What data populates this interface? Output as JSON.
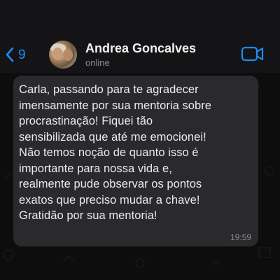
{
  "header": {
    "back_count": "9",
    "contact_name": "Andrea Goncalves",
    "status": "online",
    "accent_color": "#1e8df5"
  },
  "icons": {
    "back": "chevron-left-icon",
    "video": "video-call-icon"
  },
  "message": {
    "text": "Carla, passando para te agradecer\nimensamente por sua mentoria sobre\nprocrastinação! Fiquei tão\nsensibilizada que até me emocionei!\nNão temos noção de quanto isso é\nimportante para nossa vida e,\nrealmente pude observar os pontos\nexatos que preciso mudar a chave!\nGratidão por sua mentoria!",
    "time": "19:59"
  }
}
